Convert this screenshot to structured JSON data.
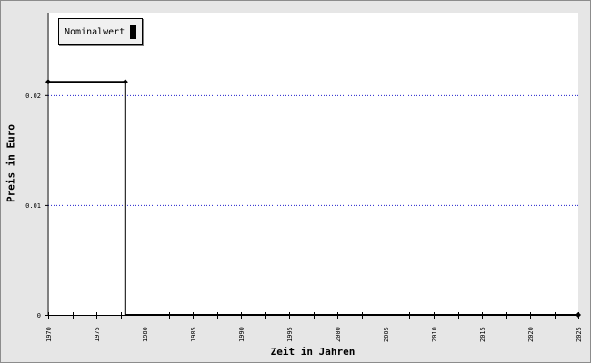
{
  "chart_data": {
    "type": "line",
    "xlabel": "Zeit in Jahren",
    "ylabel": "Preis in Euro",
    "xlim": [
      1970,
      2025
    ],
    "ylim": [
      0,
      0.0275
    ],
    "x_ticks": [
      "1970",
      "1975",
      "1980",
      "1985",
      "1990",
      "1995",
      "2000",
      "2005",
      "2010",
      "2015",
      "2020",
      "2025"
    ],
    "y_ticks": [
      "0",
      "0.01",
      "0.02"
    ],
    "grid": "horizontal dotted",
    "legend_position": "top-left",
    "series": [
      {
        "name": "Nominalwert",
        "color": "#000000",
        "step": true,
        "points": [
          [
            1970,
            0.0212
          ],
          [
            1978,
            0.0212
          ],
          [
            1978,
            0
          ],
          [
            2025,
            0
          ]
        ],
        "markers": [
          [
            1970,
            0.0212
          ],
          [
            1978,
            0.0212
          ],
          [
            2025,
            0
          ]
        ]
      }
    ]
  }
}
